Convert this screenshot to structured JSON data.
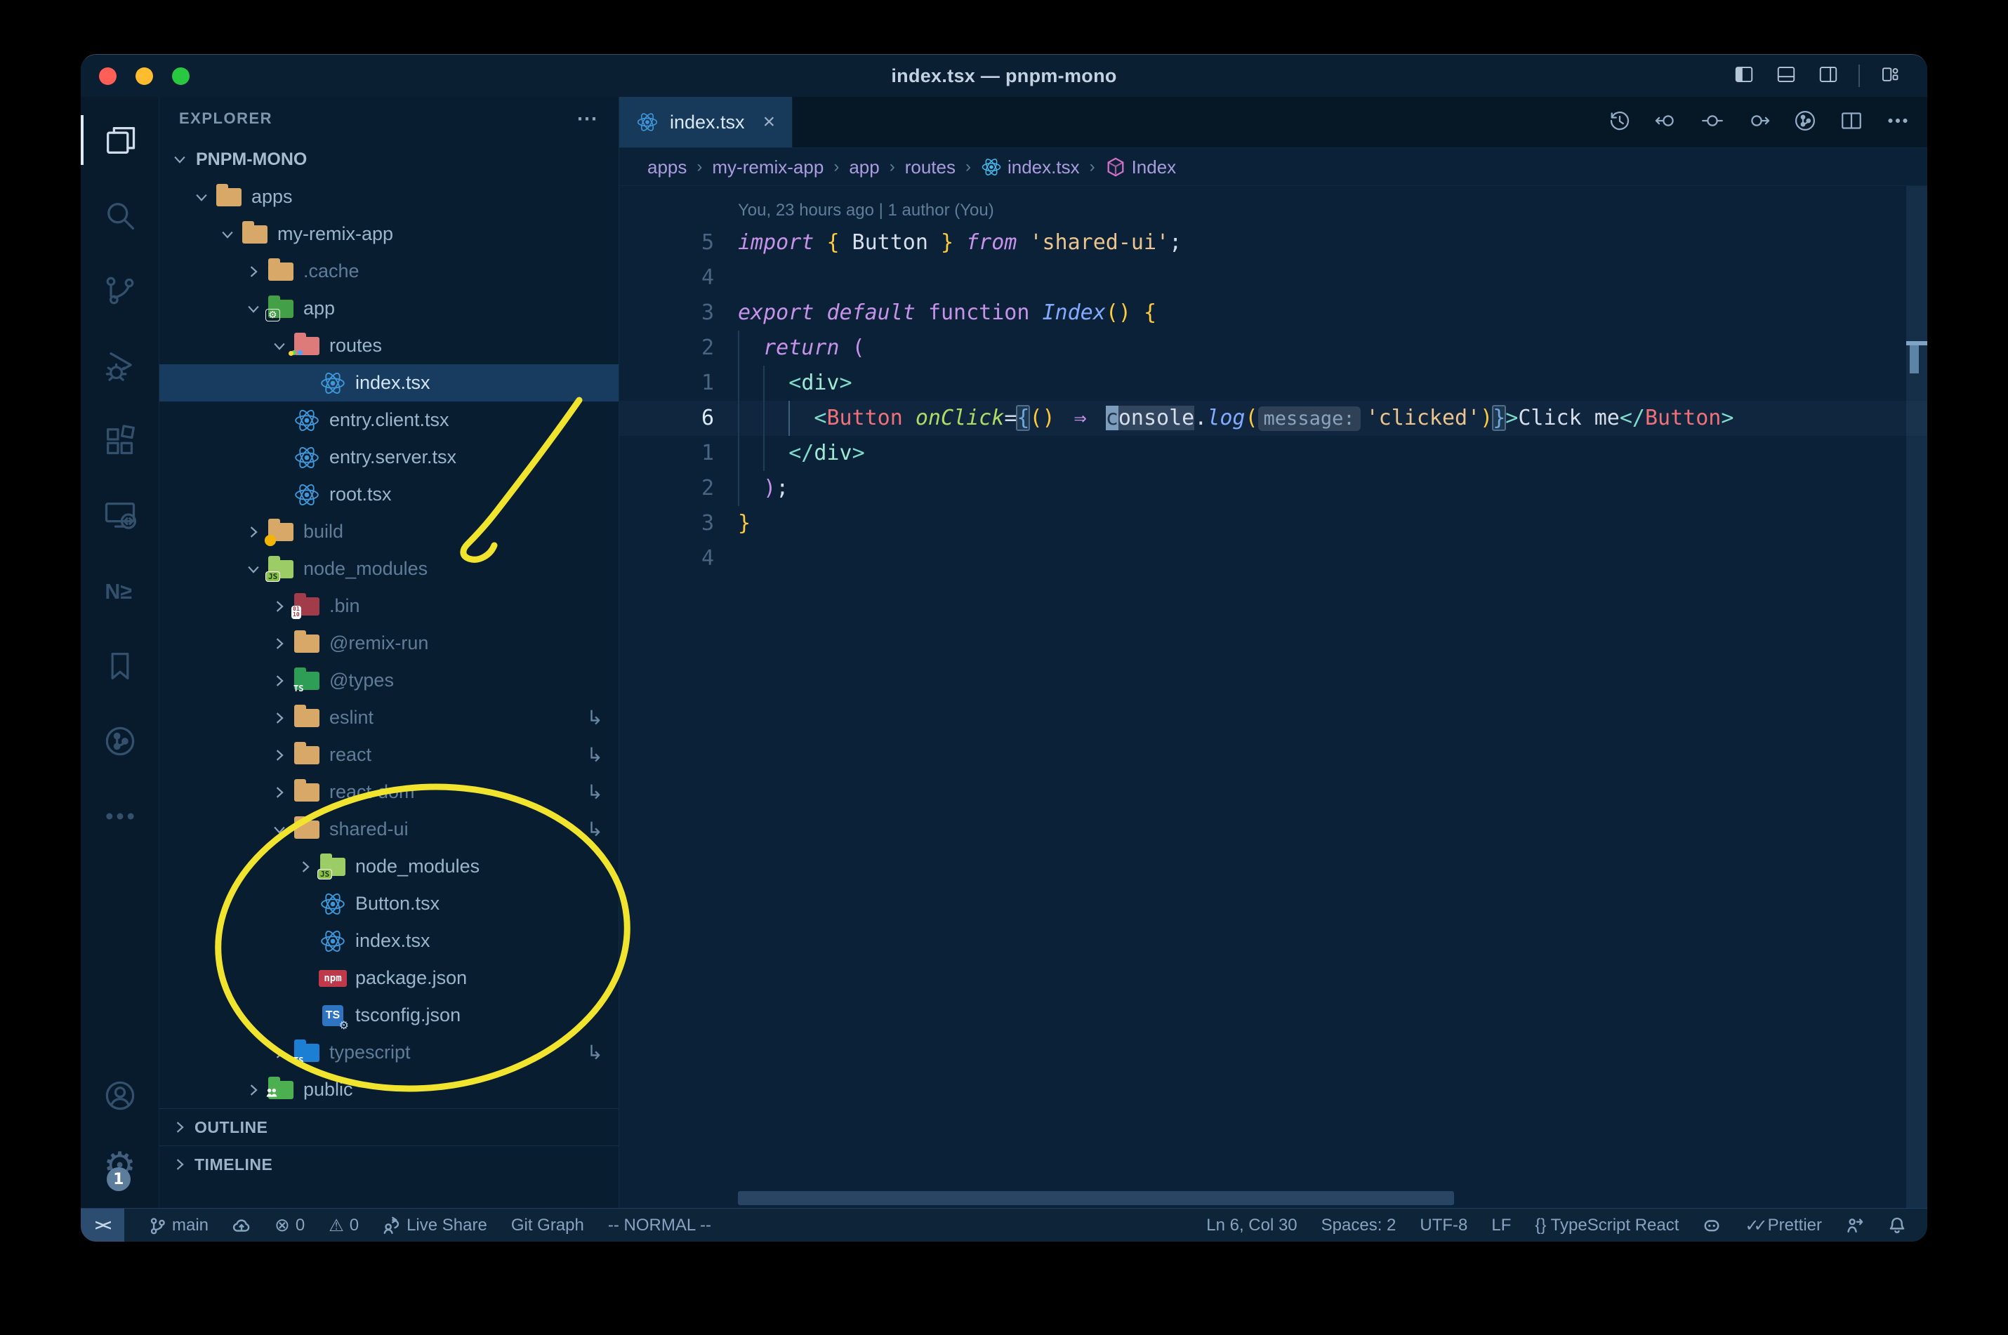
{
  "window": {
    "title": "index.tsx — pnpm-mono"
  },
  "colors": {
    "annotation": "#f1e42f",
    "traffic_red": "#ff5f57",
    "traffic_yellow": "#febc2e",
    "traffic_green": "#28c840",
    "folder_tan": "#d8a868",
    "folder_green": "#43a047",
    "folder_pink": "#dd7a7a",
    "folder_lime": "#9ccc65",
    "folder_maroon": "#a23b4a",
    "folder_dgreen": "#2e9e57",
    "folder_blue": "#1d7fd4",
    "folder_public": "#4caf50"
  },
  "activity_bar": {
    "items": [
      {
        "icon": "files",
        "name": "explorer",
        "active": true
      },
      {
        "icon": "search",
        "name": "search"
      },
      {
        "icon": "scm",
        "name": "source-control"
      },
      {
        "icon": "debug",
        "name": "run-and-debug"
      },
      {
        "icon": "extensions",
        "name": "extensions"
      },
      {
        "icon": "remote",
        "name": "remote-explorer"
      },
      {
        "icon": "nx",
        "name": "nx-console"
      },
      {
        "icon": "bookmark",
        "name": "bookmarks"
      },
      {
        "icon": "gitgraph",
        "name": "git-graph"
      },
      {
        "icon": "more",
        "name": "additional-views"
      }
    ],
    "settings_badge": "1"
  },
  "sidebar": {
    "header": "EXPLORER",
    "more_label": "⋯",
    "project": "PNPM-MONO",
    "tree": [
      {
        "label": "apps",
        "depth": 1,
        "icon": "folder-tan",
        "chevron": "down"
      },
      {
        "label": "my-remix-app",
        "depth": 2,
        "icon": "folder-tan",
        "chevron": "down"
      },
      {
        "label": ".cache",
        "depth": 3,
        "icon": "folder-tan",
        "chevron": "right",
        "dim": true
      },
      {
        "label": "app",
        "depth": 3,
        "icon": "folder-app",
        "chevron": "down"
      },
      {
        "label": "routes",
        "depth": 4,
        "icon": "folder-routes",
        "chevron": "down"
      },
      {
        "label": "index.tsx",
        "depth": 5,
        "icon": "react",
        "selected": true
      },
      {
        "label": "entry.client.tsx",
        "depth": 4,
        "icon": "react"
      },
      {
        "label": "entry.server.tsx",
        "depth": 4,
        "icon": "react"
      },
      {
        "label": "root.tsx",
        "depth": 4,
        "icon": "react"
      },
      {
        "label": "build",
        "depth": 3,
        "icon": "folder-build",
        "chevron": "right",
        "dim": true
      },
      {
        "label": "node_modules",
        "depth": 3,
        "icon": "folder-node",
        "chevron": "down",
        "dim": true
      },
      {
        "label": ".bin",
        "depth": 4,
        "icon": "folder-bin",
        "chevron": "right",
        "dim": true
      },
      {
        "label": "@remix-run",
        "depth": 4,
        "icon": "folder-tan",
        "chevron": "right",
        "dim": true
      },
      {
        "label": "@types",
        "depth": 4,
        "icon": "folder-types",
        "chevron": "right",
        "dim": true
      },
      {
        "label": "eslint",
        "depth": 4,
        "icon": "folder-tan",
        "chevron": "right",
        "dim": true,
        "symlink": true
      },
      {
        "label": "react",
        "depth": 4,
        "icon": "folder-tan",
        "chevron": "right",
        "dim": true,
        "symlink": true
      },
      {
        "label": "react-dom",
        "depth": 4,
        "icon": "folder-tan",
        "chevron": "right",
        "dim": true,
        "symlink": true
      },
      {
        "label": "shared-ui",
        "depth": 4,
        "icon": "folder-tan",
        "chevron": "down",
        "dim": true,
        "symlink": true
      },
      {
        "label": "node_modules",
        "depth": 5,
        "icon": "folder-node",
        "chevron": "right"
      },
      {
        "label": "Button.tsx",
        "depth": 5,
        "icon": "react"
      },
      {
        "label": "index.tsx",
        "depth": 5,
        "icon": "react"
      },
      {
        "label": "package.json",
        "depth": 5,
        "icon": "npm"
      },
      {
        "label": "tsconfig.json",
        "depth": 5,
        "icon": "tsgear"
      },
      {
        "label": "typescript",
        "depth": 4,
        "icon": "folder-ts",
        "chevron": "right",
        "dim": true,
        "symlink": true
      },
      {
        "label": "public",
        "depth": 3,
        "icon": "folder-public",
        "chevron": "right"
      }
    ],
    "sections": [
      "OUTLINE",
      "TIMELINE"
    ]
  },
  "tab": {
    "label": "index.tsx",
    "close": "×"
  },
  "editor_actions": [
    {
      "icon": "history",
      "name": "timeline-history"
    },
    {
      "icon": "navback",
      "name": "previous-change"
    },
    {
      "icon": "navdot",
      "name": "goto-change"
    },
    {
      "icon": "navfwd",
      "name": "next-change"
    },
    {
      "icon": "gitgraph",
      "name": "git-graph-view"
    },
    {
      "icon": "split",
      "name": "split-editor"
    },
    {
      "icon": "more",
      "name": "more-actions"
    }
  ],
  "breadcrumbs": [
    {
      "text": "apps"
    },
    {
      "text": "my-remix-app"
    },
    {
      "text": "app"
    },
    {
      "text": "routes"
    },
    {
      "text": "index.tsx",
      "icon": "react"
    },
    {
      "text": "Index",
      "icon": "symbol-cube"
    }
  ],
  "editor": {
    "codelens": "You, 23 hours ago | 1 author (You)",
    "lines": [
      {
        "n": "5",
        "g": [],
        "seg": [
          {
            "c": "kw",
            "t": "import"
          },
          {
            "c": "txt",
            "t": " "
          },
          {
            "c": "gold",
            "t": "{"
          },
          {
            "c": "txt",
            "t": " Button "
          },
          {
            "c": "gold",
            "t": "}"
          },
          {
            "c": "txt",
            "t": " "
          },
          {
            "c": "kw",
            "t": "from"
          },
          {
            "c": "txt",
            "t": " "
          },
          {
            "c": "str",
            "t": "'shared-ui'"
          },
          {
            "c": "txt",
            "t": ";"
          }
        ]
      },
      {
        "n": "4",
        "g": [],
        "seg": []
      },
      {
        "n": "3",
        "g": [],
        "seg": [
          {
            "c": "kw",
            "t": "export"
          },
          {
            "c": "txt",
            "t": " "
          },
          {
            "c": "kw",
            "t": "default"
          },
          {
            "c": "txt",
            "t": " "
          },
          {
            "c": "kwn",
            "t": "function"
          },
          {
            "c": "txt",
            "t": " "
          },
          {
            "c": "fn",
            "t": "Index"
          },
          {
            "c": "gold",
            "t": "()"
          },
          {
            "c": "txt",
            "t": " "
          },
          {
            "c": "gold",
            "t": "{"
          }
        ]
      },
      {
        "n": "2",
        "g": [
          0
        ],
        "seg": [
          {
            "c": "txt",
            "t": "  "
          },
          {
            "c": "kw",
            "t": "return"
          },
          {
            "c": "txt",
            "t": " "
          },
          {
            "c": "kwn",
            "t": "("
          }
        ]
      },
      {
        "n": "1",
        "g": [
          0,
          2
        ],
        "seg": [
          {
            "c": "txt",
            "t": "    "
          },
          {
            "c": "pun",
            "t": "<"
          },
          {
            "c": "tagc",
            "t": "div"
          },
          {
            "c": "pun",
            "t": ">"
          }
        ]
      },
      {
        "n": "6",
        "active": true,
        "g": [
          0,
          2,
          4
        ],
        "ag": 4,
        "seg": [
          {
            "c": "txt",
            "t": "      "
          },
          {
            "c": "pun",
            "t": "<"
          },
          {
            "c": "tag",
            "t": "Button"
          },
          {
            "c": "txt",
            "t": " "
          },
          {
            "c": "attr",
            "t": "onClick"
          },
          {
            "c": "op",
            "t": "="
          },
          {
            "c": "jsxb",
            "t": "{"
          },
          {
            "c": "gold",
            "t": "()"
          },
          {
            "c": "txt",
            "t": " "
          },
          {
            "c": "arrow",
            "t": "⇒"
          },
          {
            "c": "txt",
            "t": " "
          },
          {
            "c": "cursor",
            "t": "c"
          },
          {
            "c": "hl",
            "t": "onsole"
          },
          {
            "c": "op",
            "t": "."
          },
          {
            "c": "fn",
            "t": "log"
          },
          {
            "c": "gold",
            "t": "("
          },
          {
            "c": "inlay",
            "t": "message:"
          },
          {
            "c": "str",
            "t": "'clicked'"
          },
          {
            "c": "gold",
            "t": ")"
          },
          {
            "c": "jsxb",
            "t": "}"
          },
          {
            "c": "pun",
            "t": ">"
          },
          {
            "c": "txt",
            "t": "Click me"
          },
          {
            "c": "pun",
            "t": "</"
          },
          {
            "c": "tag",
            "t": "Button"
          },
          {
            "c": "pun",
            "t": ">"
          }
        ]
      },
      {
        "n": "1",
        "g": [
          0,
          2
        ],
        "seg": [
          {
            "c": "txt",
            "t": "    "
          },
          {
            "c": "pun",
            "t": "</"
          },
          {
            "c": "tagc",
            "t": "div"
          },
          {
            "c": "pun",
            "t": ">"
          }
        ]
      },
      {
        "n": "2",
        "g": [
          0
        ],
        "seg": [
          {
            "c": "txt",
            "t": "  "
          },
          {
            "c": "kwn",
            "t": ")"
          },
          {
            "c": "txt",
            "t": ";"
          }
        ]
      },
      {
        "n": "3",
        "g": [],
        "seg": [
          {
            "c": "gold",
            "t": "}"
          }
        ]
      },
      {
        "n": "4",
        "g": [],
        "seg": []
      }
    ]
  },
  "status_bar": {
    "left": [
      {
        "icon": "remote",
        "name": "remote-indicator",
        "boxed": true
      },
      {
        "icon": "branch",
        "text": "main",
        "name": "git-branch"
      },
      {
        "icon": "cloud",
        "name": "publish-changes"
      },
      {
        "icon": "error",
        "text": "0",
        "name": "errors"
      },
      {
        "icon": "warning",
        "text": "0",
        "name": "warnings"
      },
      {
        "icon": "liveshare",
        "text": "Live Share",
        "name": "live-share"
      },
      {
        "text": "Git Graph",
        "name": "git-graph"
      },
      {
        "text": "-- NORMAL --",
        "name": "vim-mode"
      }
    ],
    "right": [
      {
        "text": "Ln 6, Col 30",
        "name": "cursor-position"
      },
      {
        "text": "Spaces: 2",
        "name": "indentation"
      },
      {
        "text": "UTF-8",
        "name": "encoding"
      },
      {
        "text": "LF",
        "name": "eol"
      },
      {
        "text": "{} TypeScript React",
        "name": "language-mode"
      },
      {
        "icon": "copilot",
        "name": "copilot"
      },
      {
        "icon": "check",
        "text": "Prettier",
        "name": "prettier"
      },
      {
        "icon": "feedback",
        "name": "feedback"
      },
      {
        "icon": "bell",
        "name": "notifications"
      }
    ]
  },
  "titlebar_icons": [
    {
      "icon": "layoutleft",
      "name": "toggle-primary-sidebar"
    },
    {
      "icon": "layoutpanel",
      "name": "toggle-panel"
    },
    {
      "icon": "layoutright",
      "name": "toggle-secondary-sidebar"
    },
    {
      "icon": "sep",
      "name": "separator"
    },
    {
      "icon": "layoutcustom",
      "name": "customize-layout"
    }
  ]
}
